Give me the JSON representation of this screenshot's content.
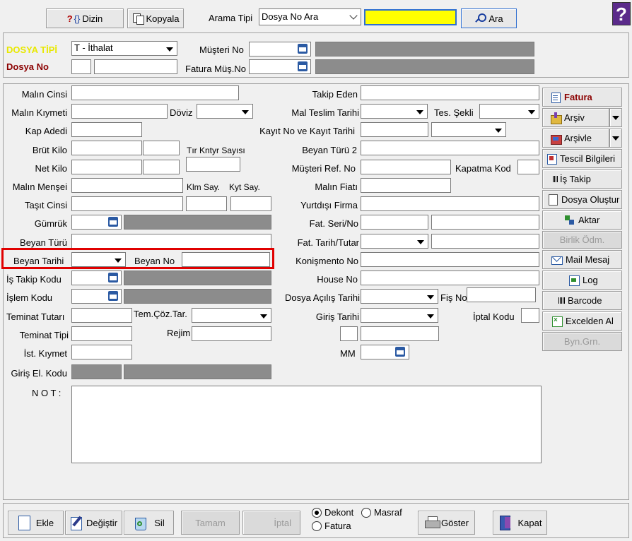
{
  "toolbar": {
    "dizin_label": "Dizin",
    "kopyala_label": "Kopyala",
    "arama_tipi_label": "Arama Tipi",
    "arama_tipi_value": "Dosya No Ara",
    "search_value": "",
    "ara_label": "Ara",
    "help_glyph": "?"
  },
  "header": {
    "dosya_tipi_label": "DOSYA TİPİ",
    "dosya_tipi_value": "T - İthalat",
    "dosya_no_label": "Dosya No",
    "musteri_no_label": "Müşteri No",
    "fatura_mus_no_label": "Fatura Müş.No"
  },
  "left": {
    "malin_cinsi": "Malın Cinsi",
    "malin_kiymeti": "Malın Kıymeti",
    "doviz": "Döviz",
    "kap_adedi": "Kap Adedi",
    "brut_kilo": "Brüt Kilo",
    "tir_kntyr_sayisi": "Tır Kntyr Sayısı",
    "net_kilo": "Net Kilo",
    "malin_mensei": "Malın Menşei",
    "klm_say": "Klm Say.",
    "kyt_say": "Kyt Say.",
    "tasit_cinsi": "Taşıt Cinsi",
    "gumruk": "Gümrük",
    "beyan_turu": "Beyan Türü",
    "beyan_tarihi": "Beyan Tarihi",
    "beyan_no": "Beyan No",
    "is_takip_kodu": "İş Takip Kodu",
    "islem_kodu": "İşlem Kodu",
    "teminat_tutari": "Teminat Tutarı",
    "tem_coz_tar": "Tem.Çöz.Tar.",
    "teminat_tipi": "Teminat Tipi",
    "rejim": "Rejim",
    "ist_kiymet": "İst. Kıymet",
    "giris_el_kodu": "Giriş El. Kodu",
    "not": "N O T :"
  },
  "middle": {
    "takip_eden": "Takip Eden",
    "mal_teslim_tarihi": "Mal Teslim Tarihi",
    "tes_sekli": "Tes. Şekli",
    "kayit_no_tarihi": "Kayıt  No  ve Kayıt Tarihi",
    "beyan_turu_2": "Beyan Türü 2",
    "musteri_ref_no": "Müşteri  Ref. No",
    "kapatma_kod": "Kapatma Kod",
    "malin_fiati": "Malın Fiatı",
    "yurtdisi_firma": "Yurtdışı Firma",
    "fat_seri_no": "Fat. Seri/No",
    "fat_tarih_tutar": "Fat. Tarih/Tutar",
    "konismento_no": "Konişmento No",
    "house_no": "House No",
    "dosya_acilis_tarihi": "Dosya Açılış Tarihi",
    "fis_no": "Fiş No",
    "giris_tarihi": "Giriş Tarihi",
    "iptal_kodu": "İptal Kodu",
    "mm": "MM"
  },
  "side": {
    "fatura": "Fatura",
    "arsiv": "Arşiv",
    "arsivle": "Arşivle",
    "tescil": "Tescil Bilgileri",
    "is_takip": "İş Takip",
    "dosya_olustur": "Dosya Oluştur",
    "aktar": "Aktar",
    "birlik_odm": "Birlik Ödm.",
    "mail_mesaj": "Mail Mesaj",
    "log": "Log",
    "barcode": "Barcode",
    "excelden_al": "Excelden Al",
    "byn_grn": "Byn.Grn."
  },
  "bottom": {
    "ekle": "Ekle",
    "degistir": "Değiştir",
    "sil": "Sil",
    "tamam": "Tamam",
    "iptal": "İptal",
    "dekont": "Dekont",
    "masraf": "Masraf",
    "fatura": "Fatura",
    "goster": "Göster",
    "kapat": "Kapat"
  },
  "colors": {
    "search_highlight": "#ffff00",
    "dosya_tipi_label": "#e8e800",
    "dosya_no_label": "#8b0000",
    "fatura_label": "#8b0000",
    "focus_outline": "#e00000",
    "readonly_field": "#8c8c8c"
  }
}
